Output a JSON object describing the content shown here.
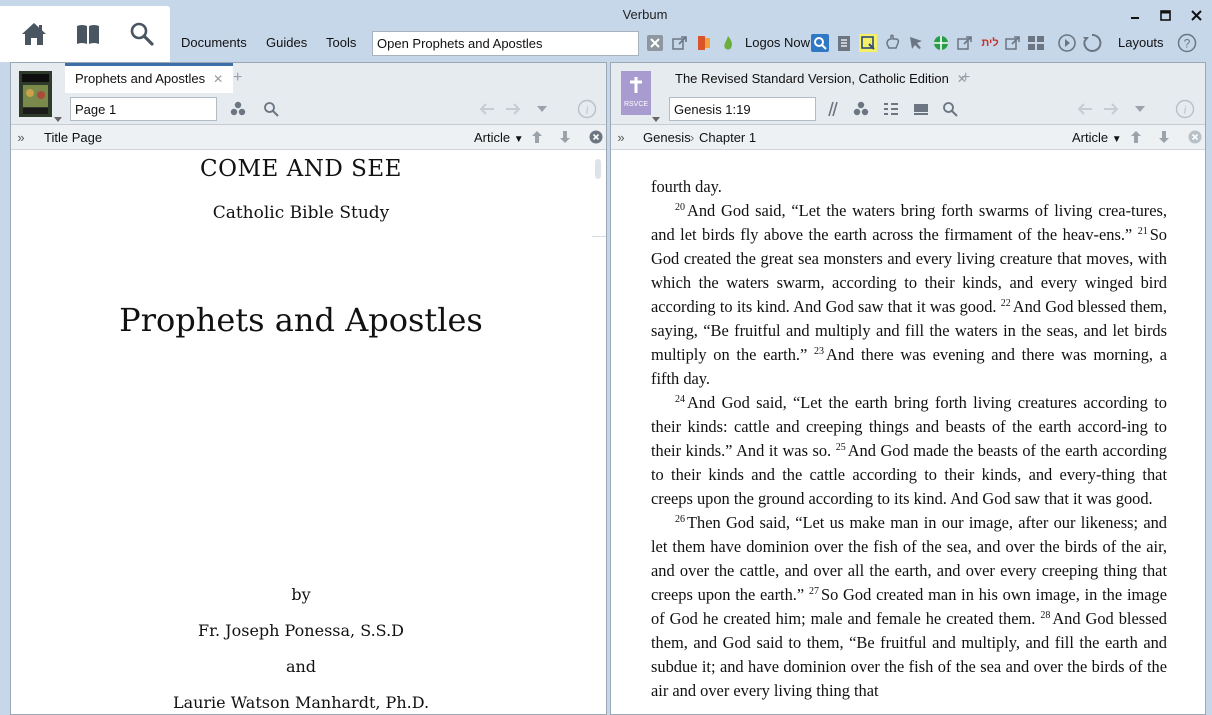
{
  "app": {
    "title": "Verbum",
    "menu": [
      "Documents",
      "Guides",
      "Tools"
    ],
    "command_box": "Open Prophets and Apostles",
    "logos_now": "Logos Now",
    "layouts": "Layouts",
    "hebrew_label": "לית"
  },
  "left_panel": {
    "tab_title": "Prophets and Apostles",
    "page_ref": "Page 1",
    "section": "Title Page",
    "article_label": "Article",
    "title_page": {
      "series": "COME AND SEE",
      "subtitle": "Catholic Bible Study",
      "title": "Prophets and Apostles",
      "by": "by",
      "author1": "Fr. Joseph Ponessa, S.S.D",
      "and": "and",
      "author2": "Laurie Watson Manhardt, Ph.D."
    }
  },
  "right_panel": {
    "tab_title": "The Revised Standard Version, Catholic Edition",
    "badge": "RSVCE",
    "reference": "Genesis 1:19",
    "breadcrumb": [
      "Genesis",
      "Chapter 1"
    ],
    "article_label": "Article",
    "paragraphs": [
      [
        {
          "t": "fourth day."
        }
      ],
      [
        {
          "v": "20"
        },
        {
          "t": "And God said, “Let the waters bring forth swarms of living crea-tures, and let birds fly above the earth across the firmament of the heav-ens.” "
        },
        {
          "v": "21"
        },
        {
          "t": "So God created the great sea monsters and every living creature that moves, with which the waters swarm, according to their kinds, and every winged bird according to its kind. And God saw that it was good. "
        },
        {
          "v": "22"
        },
        {
          "t": "And God blessed them, saying, “Be fruitful and multiply and fill the waters in the seas, and let birds multiply on the earth.” "
        },
        {
          "v": "23"
        },
        {
          "t": "And there was evening and there was morning, a fifth day."
        }
      ],
      [
        {
          "v": "24"
        },
        {
          "t": "And God said, “Let the earth bring forth living creatures according to their kinds: cattle and creeping things and beasts of the earth accord-ing to their kinds.” And it was so. "
        },
        {
          "v": "25"
        },
        {
          "t": "And God made the beasts of the earth according to their kinds and the cattle according to their kinds, and every-thing that creeps upon the ground according to its kind. And God saw that it was good."
        }
      ],
      [
        {
          "v": "26"
        },
        {
          "t": "Then God said, “Let us make man in our image, after our likeness; and let them have dominion over the fish of the sea, and over the birds of the air, and over the cattle, and over all the earth, and over every creeping thing that creeps upon the earth.” "
        },
        {
          "v": "27"
        },
        {
          "t": "So God created man in his own image, in the image of God he created him; male and female he created them. "
        },
        {
          "v": "28"
        },
        {
          "t": "And God blessed them, and God said to them, “Be fruitful and multiply, and fill the earth and subdue it; and have dominion over the fish of the sea and over the birds of the air and over every living thing that"
        }
      ]
    ]
  }
}
